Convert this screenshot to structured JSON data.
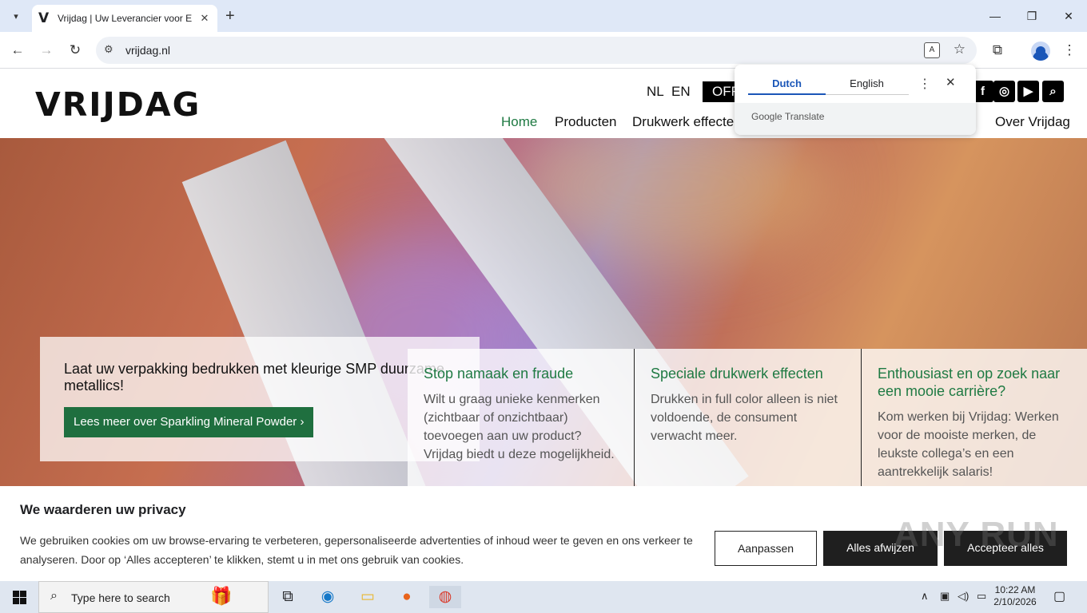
{
  "browser": {
    "tab_title": "Vrijdag | Uw Leverancier voor E",
    "tab_favicon": "V",
    "url": "vrijdag.nl"
  },
  "site": {
    "logo": "VRIJDAG",
    "lang": [
      "NL",
      "EN"
    ],
    "offerte": "OFF",
    "nav": [
      "Home",
      "Producten",
      "Drukwerk effecten",
      "Over Vrijdag"
    ],
    "social_icons": [
      "facebook-icon",
      "instagram-icon",
      "youtube-icon",
      "search-icon"
    ]
  },
  "hero": {
    "promo_title": "Laat uw verpakking bedrukken met kleurige SMP duurzame metallics!",
    "promo_button": "Lees meer over Sparkling Mineral Powder ›"
  },
  "cards": [
    {
      "title": "Stop namaak en fraude",
      "text": "Wilt u graag unieke kenmerken (zichtbaar of onzichtbaar) toevoegen aan uw product? Vrijdag biedt u deze mogelijkheid."
    },
    {
      "title": "Speciale drukwerk effecten",
      "text": "Drukken in full color alleen is niet voldoende, de consument verwacht meer."
    },
    {
      "title": "Enthousiast en op zoek naar een mooie carrière?",
      "text": "Kom werken bij Vrijdag: Werken voor de mooiste merken, de leukste collega’s en een aantrekkelijk salaris!"
    }
  ],
  "translate": {
    "source": "Dutch",
    "target": "English",
    "footer": "Google Translate"
  },
  "cookie": {
    "title": "We waarderen uw privacy",
    "text": "We gebruiken cookies om uw browse-ervaring te verbeteren, gepersonaliseerde advertenties of inhoud weer te geven en ons verkeer te analyseren. Door op ‘Alles accepteren’ te klikken, stemt u in met ons gebruik van cookies.",
    "btn_customize": "Aanpassen",
    "btn_reject": "Alles afwijzen",
    "btn_accept": "Accepteer alles",
    "watermark": "ANY RUN"
  },
  "taskbar": {
    "search_placeholder": "Type here to search",
    "time": "10:22 AM",
    "date": "2/10/2026"
  }
}
